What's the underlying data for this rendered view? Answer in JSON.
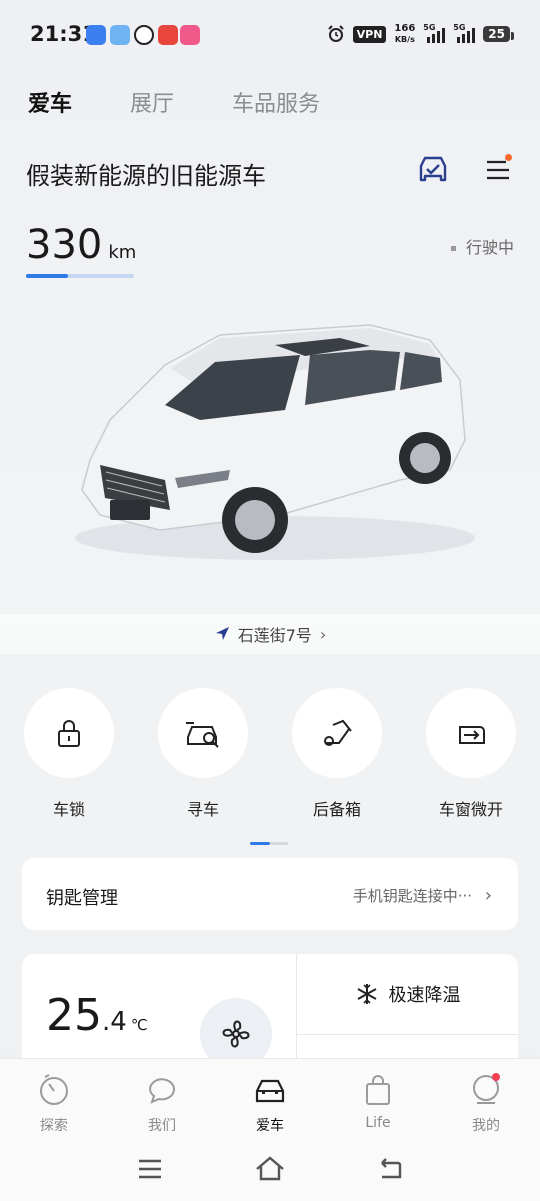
{
  "status_bar": {
    "time": "21:31",
    "vpn": "VPN",
    "speed_value": "166",
    "speed_unit": "KB/s",
    "network1": "5G",
    "network2": "5G",
    "battery": "25"
  },
  "tabs": [
    {
      "label": "爱车",
      "active": true
    },
    {
      "label": "展厅",
      "active": false
    },
    {
      "label": "车品服务",
      "active": false
    }
  ],
  "car": {
    "name": "假装新能源的旧能源车",
    "range_value": "330",
    "range_unit": "km",
    "range_fill_fraction": 0.39,
    "drive_status": "行驶中",
    "location": "石莲街7号"
  },
  "actions": [
    {
      "label": "车锁",
      "icon": "lock-icon"
    },
    {
      "label": "寻车",
      "icon": "find-car-icon"
    },
    {
      "label": "后备箱",
      "icon": "trunk-icon"
    },
    {
      "label": "车窗微开",
      "icon": "window-icon"
    }
  ],
  "key_management": {
    "title": "钥匙管理",
    "status": "手机钥匙连接中···"
  },
  "climate": {
    "temp_int": "25",
    "temp_dec": ".4",
    "temp_unit": "℃",
    "quick_cool": "极速降温"
  },
  "bottom_nav": [
    {
      "label": "探索",
      "icon": "explore-icon",
      "active": false
    },
    {
      "label": "我们",
      "icon": "chat-icon",
      "active": false
    },
    {
      "label": "爱车",
      "icon": "car-icon",
      "active": true
    },
    {
      "label": "Life",
      "icon": "shopping-bag-icon",
      "active": false
    },
    {
      "label": "我的",
      "icon": "profile-icon",
      "active": false
    }
  ],
  "colors": {
    "accent": "#2e7be6",
    "badge": "#f26b2a",
    "card": "#ffffff"
  }
}
